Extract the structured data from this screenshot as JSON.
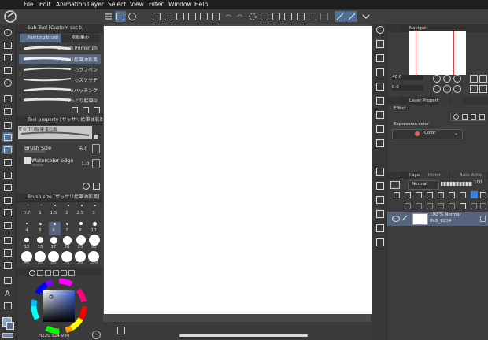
{
  "menu": {
    "apple": "",
    "items": [
      "File",
      "Edit",
      "Animation",
      "Layer",
      "Select",
      "View",
      "Filter",
      "Window",
      "Help"
    ]
  },
  "subtool": {
    "header": "Sub Tool [Custom set b]",
    "tab_active": "Painting brush",
    "tab_other": "水彩筆心",
    "brushes": [
      "Gwash Primer ph",
      "ザッサリ絵筆油彩風",
      "◇ラフペン",
      "◇スケッチ",
      "◇ハッチング",
      "べっとり絵筆②"
    ]
  },
  "toolprop": {
    "header": "Tool property [ザッサリ絵筆油彩風]",
    "preview_name": "ザッサリ絵筆油彩風",
    "brush_size_label": "Brush Size",
    "brush_size_value": "6.0",
    "watercolor_label": "Watercolor edge",
    "watercolor_value": "1.0"
  },
  "brushsize": {
    "header": "Brush size [ザッサリ絵筆油彩風]",
    "labels": [
      "0.7",
      "1",
      "1.5",
      "2",
      "2.5",
      "3",
      "4",
      "5",
      "6",
      "7",
      "8",
      "10",
      "12",
      "15",
      "17",
      "20",
      "25",
      "30",
      "40",
      "50",
      "60",
      "70",
      "80",
      "100"
    ]
  },
  "color": {
    "h_value": "220",
    "s_value": "24",
    "v_value": "84"
  },
  "navigator": {
    "tab": "Navigat",
    "zoom": "40.0",
    "angle": "0.0"
  },
  "layerprop": {
    "tab": "Layer Propert",
    "effect_label": "Effect",
    "expression_label": "Expression color",
    "expression_value": "Color"
  },
  "layer": {
    "tab": "Layer",
    "tab2": "Histor",
    "tab3": "Auto Actio",
    "blend_mode": "Normal",
    "opacity": "100",
    "layer_opacity_mode": "100 %  Normal",
    "layer_name": "IMG_8234"
  }
}
